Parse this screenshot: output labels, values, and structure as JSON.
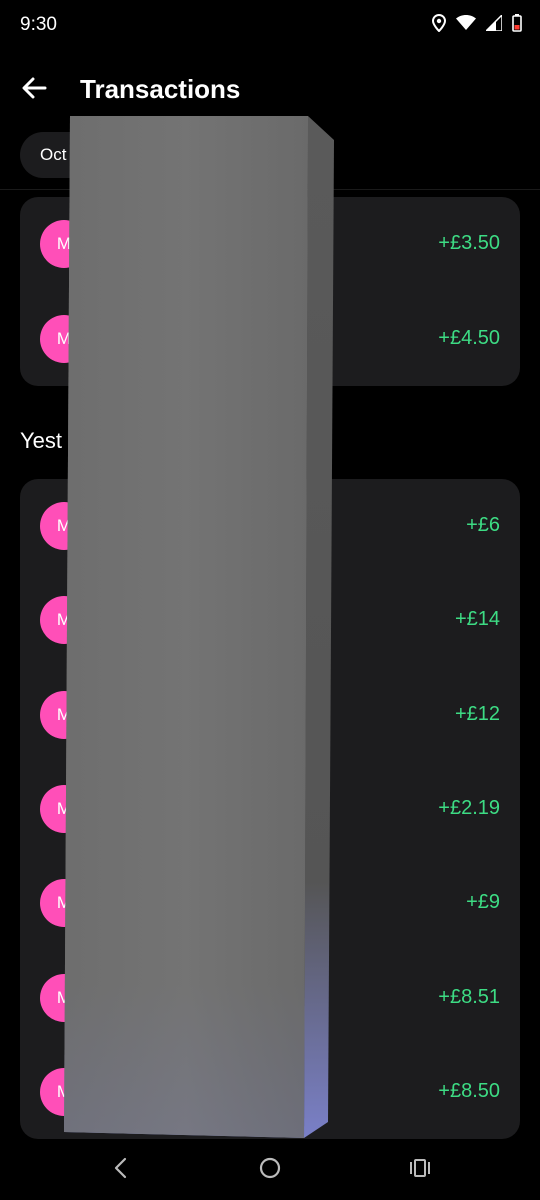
{
  "status_bar": {
    "time": "9:30",
    "icons": [
      "location-icon",
      "wifi-icon",
      "signal-icon",
      "battery-icon"
    ]
  },
  "header": {
    "title": "Transactions",
    "back_icon": "arrow-left-icon"
  },
  "filter": {
    "month_label": "Oct"
  },
  "sections": [
    {
      "label": "",
      "transactions": [
        {
          "avatar_initial": "M",
          "amount": "+£3.50"
        },
        {
          "avatar_initial": "M",
          "amount": "+£4.50"
        }
      ]
    },
    {
      "label": "Yest",
      "transactions": [
        {
          "avatar_initial": "M",
          "amount": "+£6"
        },
        {
          "avatar_initial": "M",
          "amount": "+£14"
        },
        {
          "avatar_initial": "M",
          "amount": "+£12"
        },
        {
          "avatar_initial": "M",
          "amount": "+£2.19"
        },
        {
          "avatar_initial": "M",
          "amount": "+£9"
        },
        {
          "avatar_initial": "M",
          "amount": "+£8.51"
        },
        {
          "avatar_initial": "M",
          "amount": "+£8.50"
        }
      ]
    }
  ],
  "nav": {
    "back": "nav-back-icon",
    "home": "nav-home-icon",
    "recents": "nav-recents-icon"
  },
  "colors": {
    "background": "#000000",
    "card": "#1c1c1e",
    "avatar": "#ff4fb8",
    "amount_positive": "#3ddc84"
  }
}
